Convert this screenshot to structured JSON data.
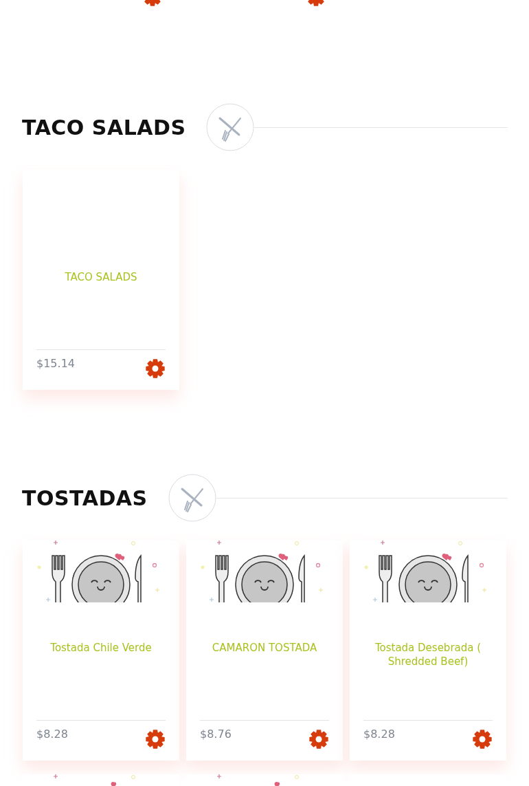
{
  "sections": [
    {
      "items": [
        {
          "kind": "cut"
        },
        {
          "kind": "cut"
        }
      ]
    },
    {
      "title": "TACO SALADS",
      "items": [
        {
          "kind": "card",
          "picture": false,
          "name": "TACO SALADS",
          "price": "$15.14"
        }
      ]
    },
    {
      "title": "TOSTADAS",
      "items": [
        {
          "kind": "card",
          "picture": true,
          "name": "Tostada Chile Verde",
          "price": "$8.28"
        },
        {
          "kind": "card",
          "picture": true,
          "name": "CAMARON TOSTADA",
          "price": "$8.76"
        },
        {
          "kind": "card",
          "picture": true,
          "name": "Tostada Desebrada ( Shredded Beef)",
          "price": "$8.28"
        },
        {
          "kind": "top",
          "picture": true
        },
        {
          "kind": "top",
          "picture": true
        },
        {
          "kind": "top",
          "picture": false
        }
      ]
    }
  ]
}
